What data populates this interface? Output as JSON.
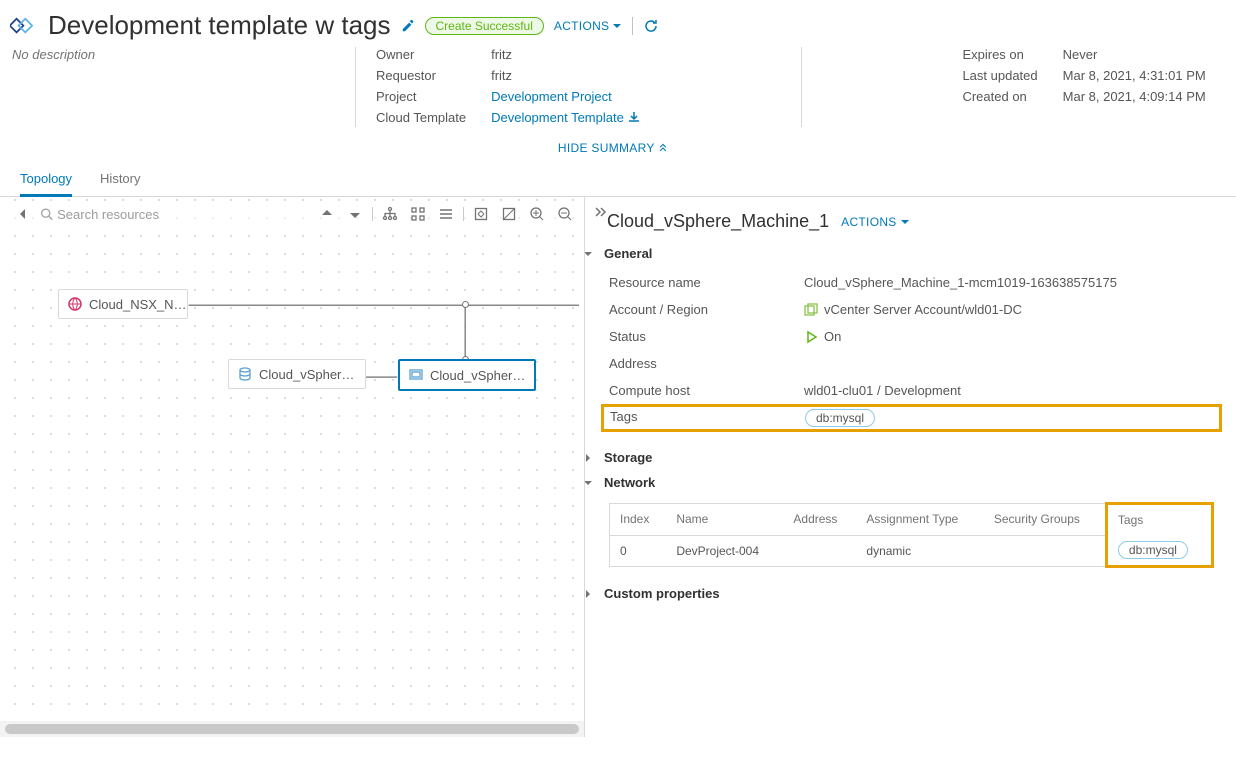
{
  "header": {
    "title": "Development template w tags",
    "status": "Create Successful",
    "actions_label": "ACTIONS",
    "no_description": "No description",
    "meta_left": {
      "owner_lbl": "Owner",
      "owner_val": "fritz",
      "requestor_lbl": "Requestor",
      "requestor_val": "fritz",
      "project_lbl": "Project",
      "project_val": "Development Project",
      "template_lbl": "Cloud Template",
      "template_val": "Development Template"
    },
    "meta_right": {
      "expires_lbl": "Expires on",
      "expires_val": "Never",
      "updated_lbl": "Last updated",
      "updated_val": "Mar 8, 2021, 4:31:01 PM",
      "created_lbl": "Created on",
      "created_val": "Mar 8, 2021, 4:09:14 PM"
    },
    "hide_summary": "HIDE SUMMARY"
  },
  "tabs": {
    "topology": "Topology",
    "history": "History"
  },
  "canvas": {
    "search_placeholder": "Search resources",
    "nodes": {
      "nsx": "Cloud_NSX_N…",
      "db": "Cloud_vSpher…",
      "vm": "Cloud_vSpher…"
    }
  },
  "panel": {
    "title": "Cloud_vSphere_Machine_1",
    "actions_label": "ACTIONS",
    "sections": {
      "general": {
        "title": "General",
        "resource_name_lbl": "Resource name",
        "resource_name_val": "Cloud_vSphere_Machine_1-mcm1019-163638575175",
        "account_lbl": "Account / Region",
        "account_val": "vCenter Server Account/wld01-DC",
        "status_lbl": "Status",
        "status_val": "On",
        "address_lbl": "Address",
        "compute_lbl": "Compute host",
        "compute_val": "wld01-clu01 / Development",
        "tags_lbl": "Tags",
        "tag_val": "db:mysql"
      },
      "storage": {
        "title": "Storage"
      },
      "network": {
        "title": "Network",
        "columns": {
          "index": "Index",
          "name": "Name",
          "address": "Address",
          "atype": "Assignment Type",
          "sgroups": "Security Groups",
          "tags": "Tags"
        },
        "row": {
          "index": "0",
          "name": "DevProject-004",
          "address": "",
          "atype": "dynamic",
          "sgroups": "",
          "tag": "db:mysql"
        }
      },
      "custom": {
        "title": "Custom properties"
      }
    }
  }
}
